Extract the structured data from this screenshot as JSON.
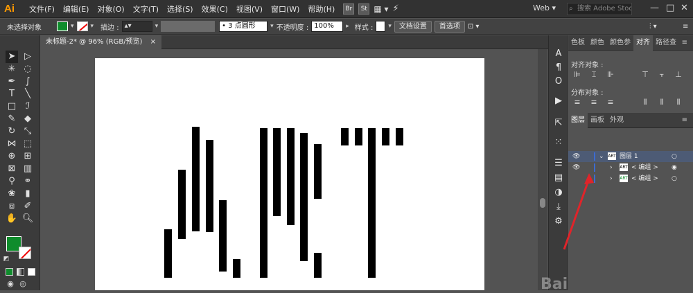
{
  "app": {
    "logo": "Ai"
  },
  "menu": [
    "文件(F)",
    "编辑(E)",
    "对象(O)",
    "文字(T)",
    "选择(S)",
    "效果(C)",
    "视图(V)",
    "窗口(W)",
    "帮助(H)"
  ],
  "menubar_icons": [
    "Br",
    "St"
  ],
  "workspace": {
    "label": "Web",
    "dropdown": "▾"
  },
  "search": {
    "placeholder": "搜索 Adobe Stock"
  },
  "window_controls": {
    "minimize": "—",
    "maximize": "□",
    "close": "✕"
  },
  "control_bar": {
    "selection_status": "未选择对象",
    "stroke_label": "描边 :",
    "brush_value": "3 点圆形",
    "opacity_label": "不透明度 :",
    "opacity_value": "100%",
    "style_label": "样式 :",
    "doc_setup_button": "文档设置",
    "preferences_button": "首选项"
  },
  "document": {
    "tab_title": "未标题-2* @ 96% (RGB/预览)",
    "close": "×"
  },
  "panels": {
    "top_tabs": [
      "色板",
      "颜色",
      "颜色参",
      "对齐",
      "路径查"
    ],
    "active_top_tab": "对齐",
    "align_objects_label": "对齐对象 :",
    "distribute_objects_label": "分布对象 :",
    "layer_tabs": [
      "图层",
      "画板",
      "外观"
    ],
    "active_layer_tab": "图层",
    "layers": [
      {
        "name": "图层 1",
        "thumb": "ART",
        "selected": true
      },
      {
        "name": "< 编组 >",
        "thumb": "ART",
        "selected": false
      },
      {
        "name": "< 编组 >",
        "thumb": "ART",
        "selected": false
      }
    ]
  },
  "colors": {
    "fill": "#0f8c2c",
    "accent_arrow": "#e0242a",
    "layer_selection": "#4d5b75"
  },
  "watermark": "Bai"
}
